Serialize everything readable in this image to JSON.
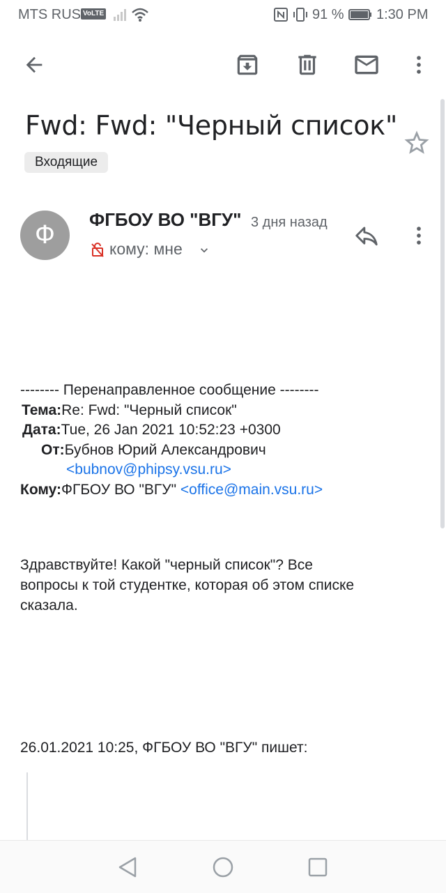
{
  "status_bar": {
    "carrier": "MTS RUS",
    "volte": "VoLTE",
    "battery": "91 %",
    "time": "1:30 PM"
  },
  "toolbar": {
    "icons": [
      "back-arrow-icon",
      "archive-icon",
      "delete-icon",
      "mark-unread-icon",
      "more-vert-icon"
    ]
  },
  "email": {
    "subject": "Fwd: Fwd: \"Черный список\"",
    "label": "Входящие",
    "avatar_letter": "Ф",
    "sender": "ФГБОУ ВО \"ВГУ\"",
    "time_ago": "3 дня назад",
    "recipient": "кому: мне"
  },
  "forwarded": {
    "header": "-------- Перенаправленное сообщение --------",
    "subject_label": "Тема:",
    "subject_value": "Re: Fwd: \"Черный список\"",
    "date_label": "Дата:",
    "date_value": "Tue, 26 Jan 2021 10:52:23 +0300",
    "from_label": "От:",
    "from_name": "Бубнов Юрий Александрович",
    "from_email": "<bubnov@phipsy.vsu.ru>",
    "to_label": "Кому:",
    "to_name": "ФГБОУ ВО \"ВГУ\" ",
    "to_email": "<office@main.vsu.ru>"
  },
  "message": {
    "line1": "Здравствуйте! Какой \"черный список\"? Все",
    "line2": "вопросы к той студентке, которая об этом списке",
    "line3": "сказала.",
    "quote_intro": "26.01.2021 10:25, ФГБОУ ВО \"ВГУ\" пишет:"
  },
  "colors": {
    "link": "#1a73e8",
    "avatar": "#9e9e9e",
    "secondary_text": "#5f6368"
  }
}
